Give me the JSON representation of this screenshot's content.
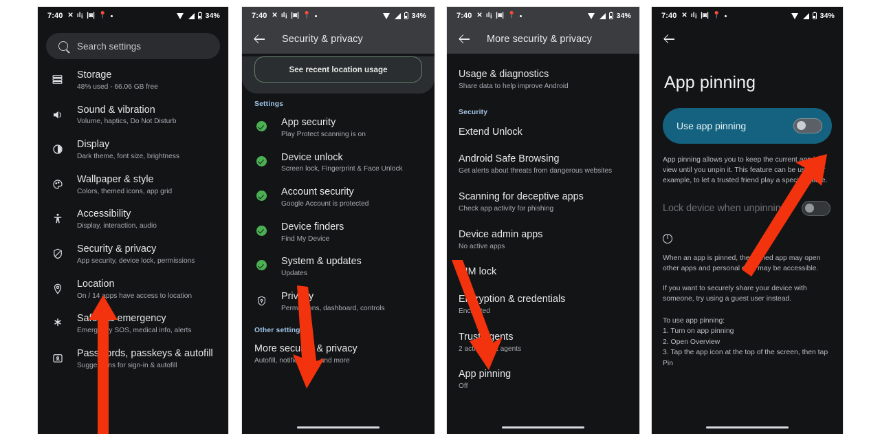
{
  "status_bar": {
    "time": "7:40",
    "battery": "34%",
    "left_icons": [
      "x-icon",
      "equalizer-icon",
      "vibrate-icon",
      "location-icon",
      "dot-icon"
    ],
    "right_icons": [
      "wifi-icon",
      "signal-icon",
      "battery-icon"
    ]
  },
  "panel1": {
    "search": {
      "placeholder": "Search settings",
      "icon": "search-icon"
    },
    "items": [
      {
        "icon": "storage-icon",
        "title": "Storage",
        "subtitle": "48% used - 66.06 GB free"
      },
      {
        "icon": "sound-icon",
        "title": "Sound & vibration",
        "subtitle": "Volume, haptics, Do Not Disturb"
      },
      {
        "icon": "display-icon",
        "title": "Display",
        "subtitle": "Dark theme, font size, brightness"
      },
      {
        "icon": "wallpaper-icon",
        "title": "Wallpaper & style",
        "subtitle": "Colors, themed icons, app grid"
      },
      {
        "icon": "accessibility-icon",
        "title": "Accessibility",
        "subtitle": "Display, interaction, audio"
      },
      {
        "icon": "shield-icon",
        "title": "Security & privacy",
        "subtitle": "App security, device lock, permissions"
      },
      {
        "icon": "location-icon",
        "title": "Location",
        "subtitle": "On / 14 apps have access to location"
      },
      {
        "icon": "emergency-icon",
        "title": "Safety & emergency",
        "subtitle": "Emergency SOS, medical info, alerts"
      },
      {
        "icon": "passwords-icon",
        "title": "Passwords, passkeys & autofill",
        "subtitle": "Suggestions for sign-in & autofill"
      }
    ]
  },
  "panel2": {
    "appbar": {
      "title": "Security & privacy",
      "back_icon": "back-arrow-icon"
    },
    "location_button": "See recent location usage",
    "section_settings": "Settings",
    "section_other": "Other settings",
    "items": [
      {
        "icon": "check-circle-icon",
        "title": "App security",
        "subtitle": "Play Protect scanning is on"
      },
      {
        "icon": "check-circle-icon",
        "title": "Device unlock",
        "subtitle": "Screen lock, Fingerprint & Face Unlock"
      },
      {
        "icon": "check-circle-icon",
        "title": "Account security",
        "subtitle": "Google Account is protected"
      },
      {
        "icon": "check-circle-icon",
        "title": "Device finders",
        "subtitle": "Find My Device"
      },
      {
        "icon": "check-circle-icon",
        "title": "System & updates",
        "subtitle": "Updates"
      },
      {
        "icon": "privacy-shield-icon",
        "title": "Privacy",
        "subtitle": "Permissions, dashboard, controls"
      }
    ],
    "other_item": {
      "title": "More security & privacy",
      "subtitle": "Autofill, notifications, and more"
    }
  },
  "panel3": {
    "appbar": {
      "title": "More security & privacy",
      "back_icon": "back-arrow-icon"
    },
    "top_item": {
      "title": "Usage & diagnostics",
      "subtitle": "Share data to help improve Android"
    },
    "section_security": "Security",
    "items": [
      {
        "title": "Extend Unlock",
        "subtitle": ""
      },
      {
        "title": "Android Safe Browsing",
        "subtitle": "Get alerts about threats from dangerous websites"
      },
      {
        "title": "Scanning for deceptive apps",
        "subtitle": "Check app activity for phishing"
      },
      {
        "title": "Device admin apps",
        "subtitle": "No active apps"
      },
      {
        "title": "SIM lock",
        "subtitle": ""
      },
      {
        "title": "Encryption & credentials",
        "subtitle": "Encrypted"
      },
      {
        "title": "Trust agents",
        "subtitle": "2 active trust agents"
      },
      {
        "title": "App pinning",
        "subtitle": "Off"
      }
    ]
  },
  "panel4": {
    "back_icon": "back-arrow-icon",
    "title": "App pinning",
    "toggle_main": {
      "label": "Use app pinning",
      "state": "off"
    },
    "description": "App pinning allows you to keep the current app in view until you unpin it. This feature can be used, for example, to let a trusted friend play a specific game.",
    "toggle_lock": {
      "label": "Lock device when unpinning",
      "state": "off"
    },
    "info_icon": "info-icon",
    "note": "When an app is pinned, the pinned app may open other apps and personal data may be accessible.",
    "note2": "If you want to securely share your device with someone, try using a guest user instead.",
    "steps_header": "To use app pinning:",
    "steps": [
      "1. Turn on app pinning",
      "2. Open Overview",
      "3. Tap the app icon at the top of the screen, then tap Pin"
    ]
  },
  "annotations": {
    "arrow_color": "#f2330d",
    "arrows": [
      {
        "name": "arrow-to-security-privacy"
      },
      {
        "name": "arrow-to-more-security-privacy"
      },
      {
        "name": "arrow-to-app-pinning"
      },
      {
        "name": "arrow-to-use-app-pinning-toggle"
      }
    ]
  }
}
